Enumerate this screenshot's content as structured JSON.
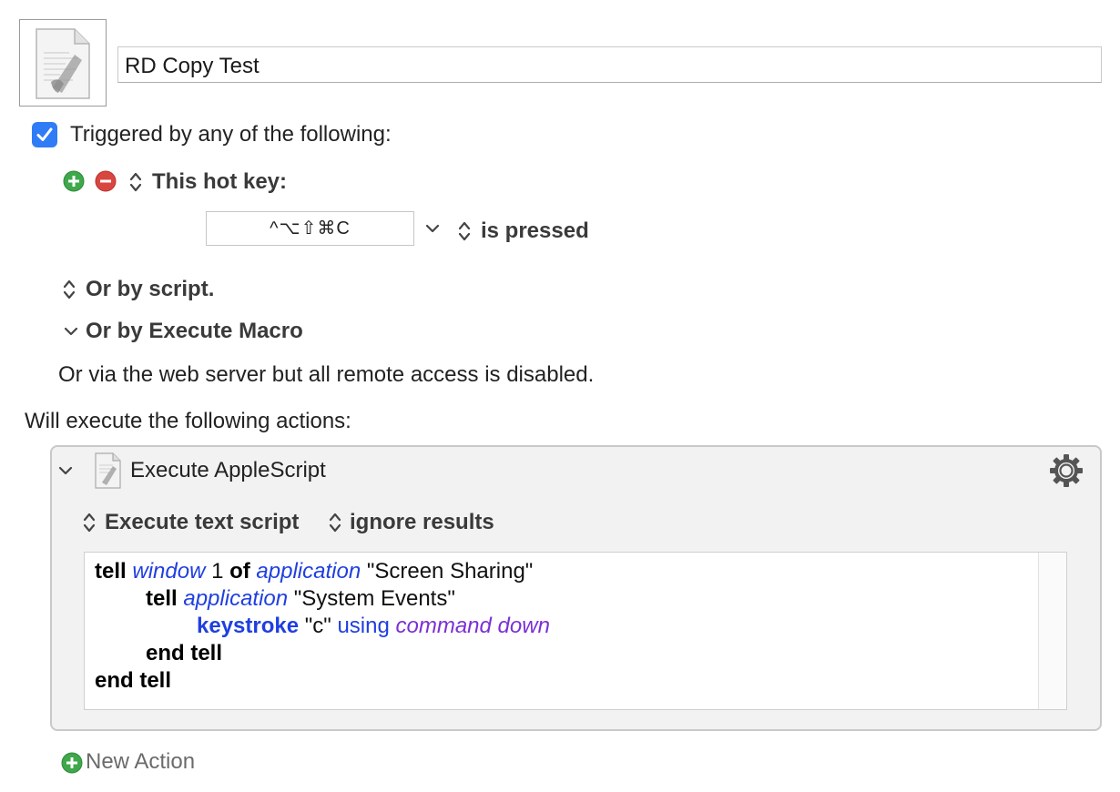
{
  "macro": {
    "name": "RD Copy Test",
    "icon": "applescript-document-icon"
  },
  "triggers": {
    "enabled_label": "Triggered by any of the following:",
    "hotkey": {
      "label": "This hot key:",
      "keys": "^⌥⇧⌘C",
      "condition": "is pressed"
    },
    "or_by_script": "Or by script.",
    "or_by_execute_macro": "Or by Execute Macro",
    "web_server_note": "Or via the web server but all remote access is disabled."
  },
  "actions": {
    "heading": "Will execute the following actions:",
    "items": [
      {
        "title": "Execute AppleScript",
        "mode": "Execute text script",
        "results": "ignore results",
        "script": {
          "l1_tell": "tell",
          "l1_window": "window",
          "l1_num": " 1 ",
          "l1_of": "of",
          "l1_app": "application",
          "l1_str": " \"Screen Sharing\"",
          "l2_tell": "tell",
          "l2_app": "application",
          "l2_str": " \"System Events\"",
          "l3_cmd": "keystroke",
          "l3_str": " \"c\" ",
          "l3_using": "using",
          "l3_enum": "command down",
          "l4": "end tell",
          "l5": "end tell"
        }
      }
    ],
    "new_action_label": "New Action"
  },
  "colors": {
    "accent": "#2f7cf6",
    "add_green": "#3fa84a",
    "remove_red": "#d9463f",
    "keyword_blue": "#1f3fe0",
    "enum_purple": "#7b2fd6"
  }
}
